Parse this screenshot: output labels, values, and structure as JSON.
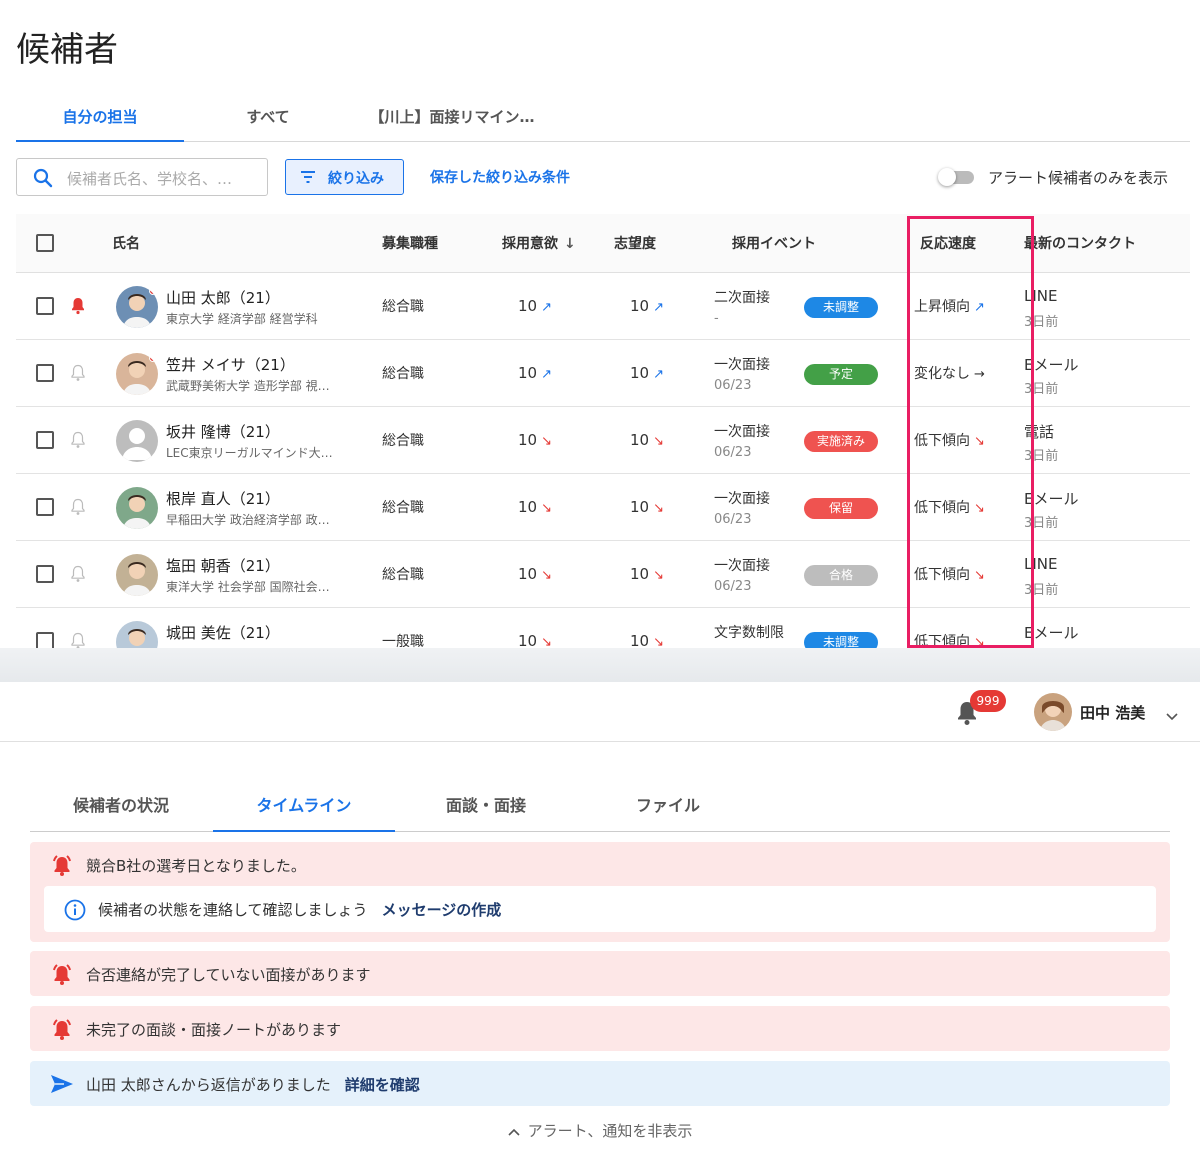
{
  "page": {
    "title": "候補者"
  },
  "tabs": [
    {
      "label": "自分の担当",
      "active": true
    },
    {
      "label": "すべて",
      "active": false
    },
    {
      "label": "【川上】面接リマイン…",
      "active": false
    }
  ],
  "toolbar": {
    "search_placeholder": "候補者氏名、学校名、…",
    "filter_label": "絞り込み",
    "saved_filters_label": "保存した絞り込み条件",
    "alert_toggle_label": "アラート候補者のみを表示"
  },
  "columns": [
    "氏名",
    "募集職種",
    "採用意欲",
    "志望度",
    "採用イベント",
    "反応速度",
    "最新のコンタクト"
  ],
  "colors": {
    "accent": "#1a73e8",
    "badge_blue": "#1e88e5",
    "badge_green": "#43a047",
    "badge_red": "#ef5350",
    "badge_gray": "#bdbdbd",
    "highlight": "#e91e63"
  },
  "rows": [
    {
      "name": "山田 太郎（21）",
      "school": "東京大学 経済学部 経営学科",
      "alert": true,
      "dot": true,
      "avatar": "photo",
      "job": "総合職",
      "intent": "10",
      "intent_dir": "up",
      "desire": "10",
      "desire_dir": "up",
      "event": "二次面接",
      "event_date": "-",
      "badge": "未調整",
      "badge_color": "blue",
      "reaction": "上昇傾向",
      "reaction_dir": "up",
      "contact": "LINE",
      "contact_date": "3日前"
    },
    {
      "name": "笠井 メイサ（21）",
      "school": "武蔵野美術大学 造形学部 視…",
      "alert": false,
      "dot": true,
      "avatar": "photo",
      "job": "総合職",
      "intent": "10",
      "intent_dir": "up",
      "desire": "10",
      "desire_dir": "up",
      "event": "一次面接",
      "event_date": "06/23",
      "badge": "予定",
      "badge_color": "green",
      "reaction": "変化なし",
      "reaction_dir": "right",
      "contact": "Eメール",
      "contact_date": "3日前"
    },
    {
      "name": "坂井 隆博（21）",
      "school": "LEC東京リーガルマインド大…",
      "alert": false,
      "dot": false,
      "avatar": "placeholder",
      "job": "総合職",
      "intent": "10",
      "intent_dir": "down",
      "desire": "10",
      "desire_dir": "down",
      "event": "一次面接",
      "event_date": "06/23",
      "badge": "実施済み",
      "badge_color": "red",
      "reaction": "低下傾向",
      "reaction_dir": "down",
      "contact": "電話",
      "contact_date": "3日前"
    },
    {
      "name": "根岸 直人（21）",
      "school": "早稲田大学 政治経済学部 政…",
      "alert": false,
      "dot": false,
      "avatar": "photo",
      "job": "総合職",
      "intent": "10",
      "intent_dir": "down",
      "desire": "10",
      "desire_dir": "down",
      "event": "一次面接",
      "event_date": "06/23",
      "badge": "保留",
      "badge_color": "red",
      "reaction": "低下傾向",
      "reaction_dir": "down",
      "contact": "Eメール",
      "contact_date": "3日前"
    },
    {
      "name": "塩田 朝香（21）",
      "school": "東洋大学 社会学部 国際社会…",
      "alert": false,
      "dot": false,
      "avatar": "photo",
      "job": "総合職",
      "intent": "10",
      "intent_dir": "down",
      "desire": "10",
      "desire_dir": "down",
      "event": "一次面接",
      "event_date": "06/23",
      "badge": "合格",
      "badge_color": "gray",
      "reaction": "低下傾向",
      "reaction_dir": "down",
      "contact": "LINE",
      "contact_date": "3日前"
    },
    {
      "name": "城田 美佐（21）",
      "school": "",
      "alert": false,
      "dot": false,
      "avatar": "photo",
      "job": "一般職",
      "intent": "10",
      "intent_dir": "down",
      "desire": "10",
      "desire_dir": "down",
      "event": "文字数制限",
      "event_date": "",
      "badge": "未調整",
      "badge_color": "blue",
      "reaction": "低下傾向",
      "reaction_dir": "down",
      "contact": "Eメール",
      "contact_date": ""
    }
  ],
  "header": {
    "notification_count": "999",
    "user_name": "田中 浩美"
  },
  "detail_tabs": [
    {
      "label": "候補者の状況",
      "active": false
    },
    {
      "label": "タイムライン",
      "active": true
    },
    {
      "label": "面談・面接",
      "active": false
    },
    {
      "label": "ファイル",
      "active": false
    }
  ],
  "alerts": {
    "a1": "競合B社の選考日となりました。",
    "a1_sub": "候補者の状態を連絡して確認しましょう",
    "a1_link": "メッセージの作成",
    "a2": "合否連絡が完了していない面接があります",
    "a3": "未完了の面談・面接ノートがあります",
    "a4": "山田 太郎さんから返信がありました",
    "a4_link": "詳細を確認",
    "hide": "アラート、通知を非表示"
  }
}
